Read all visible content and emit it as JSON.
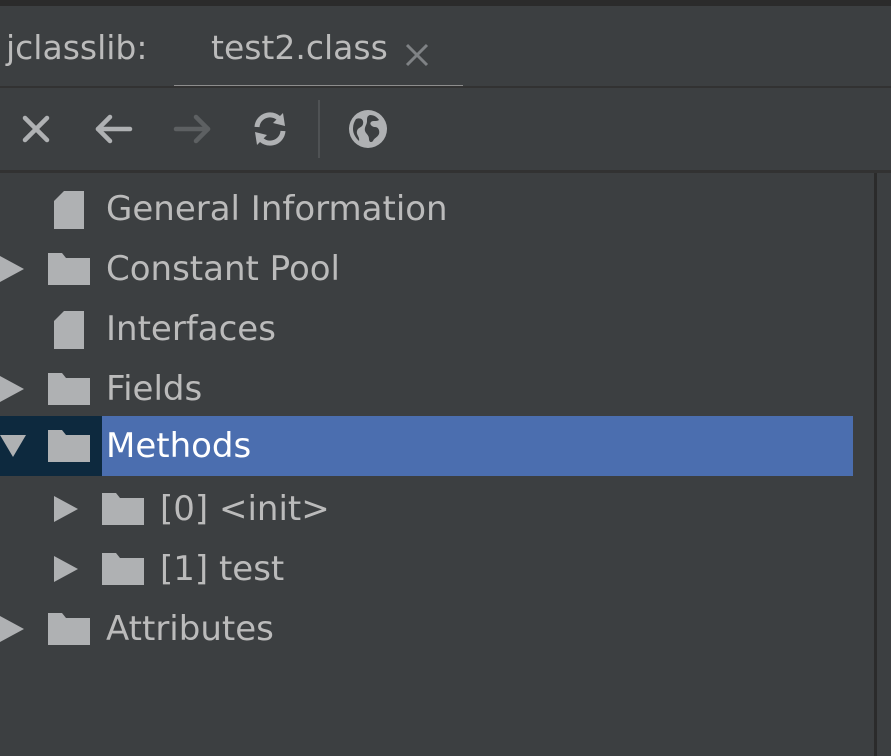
{
  "app": {
    "label": "jclasslib:"
  },
  "tabs": [
    {
      "label": "test2.class",
      "close_icon": "close-icon"
    }
  ],
  "toolbar": {
    "buttons": [
      {
        "name": "close",
        "icon": "close-icon"
      },
      {
        "name": "back",
        "icon": "arrow-left-icon"
      },
      {
        "name": "forward",
        "icon": "arrow-right-icon",
        "disabled": true
      },
      {
        "name": "refresh",
        "icon": "refresh-icon"
      },
      {
        "name": "browser",
        "icon": "globe-icon"
      }
    ]
  },
  "tree": {
    "items": [
      {
        "label": "General Information",
        "icon": "file-icon",
        "expandable": false
      },
      {
        "label": "Constant Pool",
        "icon": "folder-icon",
        "expandable": true,
        "expanded": false
      },
      {
        "label": "Interfaces",
        "icon": "file-icon",
        "expandable": false
      },
      {
        "label": "Fields",
        "icon": "folder-icon",
        "expandable": true,
        "expanded": false
      },
      {
        "label": "Methods",
        "icon": "folder-icon",
        "expandable": true,
        "expanded": true,
        "selected": true
      },
      {
        "label": "[0] <init>",
        "icon": "folder-icon",
        "expandable": true,
        "expanded": false,
        "level": 1
      },
      {
        "label": "[1] test",
        "icon": "folder-icon",
        "expandable": true,
        "expanded": false,
        "level": 1
      },
      {
        "label": "Attributes",
        "icon": "folder-icon",
        "expandable": true,
        "expanded": false
      }
    ]
  },
  "colors": {
    "background": "#3c3f41",
    "text": "#bbbbbb",
    "selection": "#4b6eaf",
    "selection_focus_gutter": "#0d293e",
    "icon": "#afb1b3"
  }
}
